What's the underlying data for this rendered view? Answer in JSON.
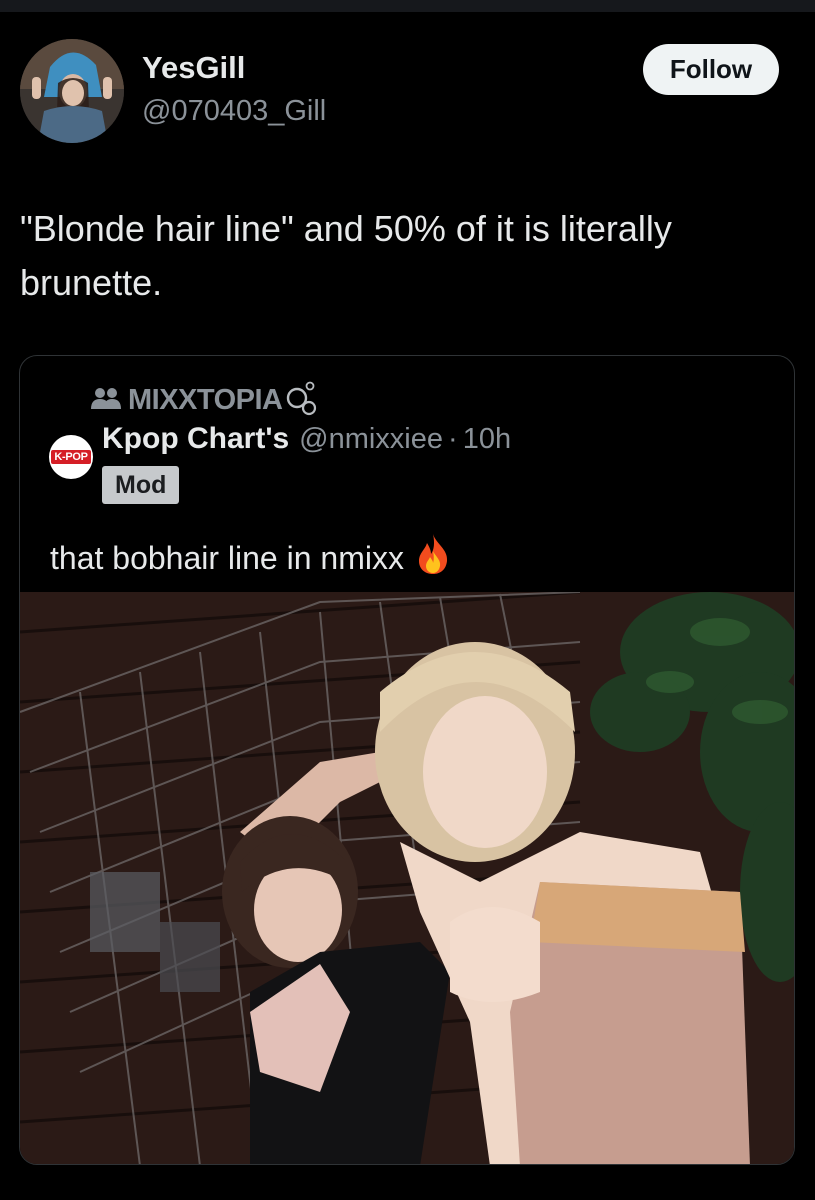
{
  "post": {
    "author_name": "YesGill",
    "author_handle": "@070403_Gill",
    "follow_label": "Follow",
    "text": "\"Blonde hair line\" and 50% of it is literally brunette."
  },
  "quote": {
    "community_name": "MIXXTOPIA",
    "community_icon": "community-people-icon",
    "author_name": "Kpop Chart's",
    "author_handle": "@nmixxiee",
    "separator": "·",
    "time": "10h",
    "badge": "Mod",
    "avatar_logo_text": "K-POP",
    "text": "that bobhair line in nmixx",
    "emoji_icon": "fire-icon"
  },
  "colors": {
    "background": "#000000",
    "primary_text": "#e7e9ea",
    "secondary_text": "#8b9299",
    "card_border": "#2f3336",
    "follow_button_bg": "#eff3f4",
    "mod_badge_bg": "#c6c9cc"
  }
}
